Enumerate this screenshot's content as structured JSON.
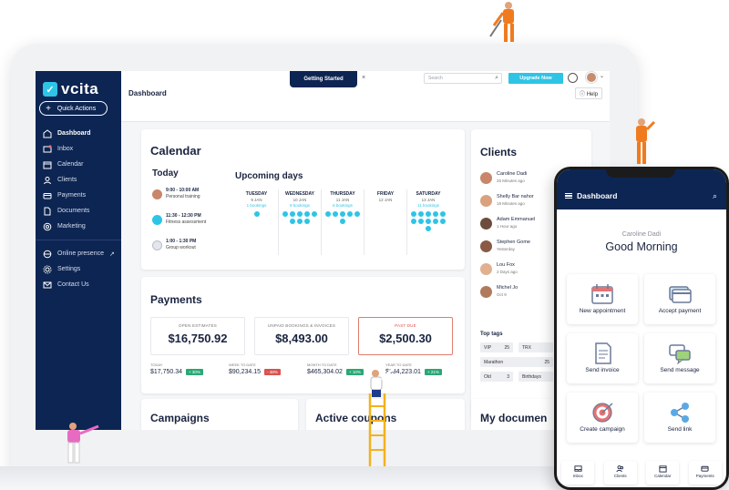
{
  "app": {
    "logo": "vcita",
    "logo_mark": "✓"
  },
  "sidebar": {
    "quick_actions": "Quick Actions",
    "items": [
      {
        "label": "Dashboard",
        "icon": "dashboard-icon"
      },
      {
        "label": "Inbox",
        "icon": "inbox-icon"
      },
      {
        "label": "Calendar",
        "icon": "calendar-icon"
      },
      {
        "label": "Clients",
        "icon": "clients-icon"
      },
      {
        "label": "Payments",
        "icon": "payments-icon"
      },
      {
        "label": "Documents",
        "icon": "documents-icon"
      },
      {
        "label": "Marketing",
        "icon": "marketing-icon"
      }
    ],
    "bottom_items": [
      {
        "label": "Online presence",
        "icon": "online-presence-icon"
      },
      {
        "label": "Settings",
        "icon": "settings-icon"
      },
      {
        "label": "Contact Us",
        "icon": "contact-icon"
      }
    ]
  },
  "header": {
    "title": "Dashboard",
    "getting_started": "Getting Started",
    "close": "×",
    "search_placeholder": "Search",
    "upgrade": "Upgrade Now",
    "help": "Help"
  },
  "calendar": {
    "title": "Calendar",
    "today_label": "Today",
    "today": [
      {
        "time": "9:00 - 10:00 AM",
        "name": "Personal training"
      },
      {
        "time": "11:30 - 12:30 PM",
        "name": "Fitness assessment"
      },
      {
        "time": "1:00 - 1:30 PM",
        "name": "Group workout"
      }
    ],
    "upcoming_label": "Upcoming days",
    "days": [
      {
        "name": "TUESDAY",
        "date": "9 JAN",
        "bookings": "1 bookings",
        "dots": 1
      },
      {
        "name": "WEDNESDAY",
        "date": "10 JAN",
        "bookings": "8 bookings",
        "dots": 8
      },
      {
        "name": "THURSDAY",
        "date": "11 JAN",
        "bookings": "6 bookings",
        "dots": 6
      },
      {
        "name": "FRIDAY",
        "date": "12 JAN",
        "bookings": "",
        "dots": 0
      },
      {
        "name": "SATURDAY",
        "date": "13 JAN",
        "bookings": "11 bookings",
        "dots": 11
      }
    ]
  },
  "clients": {
    "title": "Clients",
    "list": [
      {
        "name": "Caroline Dadi",
        "when": "25 Minutes ago"
      },
      {
        "name": "Shelly Bar nahor",
        "when": "18 Minutes ago"
      },
      {
        "name": "Adam Emmanuel",
        "when": "1 Hour ago"
      },
      {
        "name": "Stephen Gome",
        "when": "Yesterday"
      },
      {
        "name": "Lou Fox",
        "when": "2 Days ago"
      },
      {
        "name": "Michel Jo",
        "when": "Oct 9"
      }
    ],
    "tags_label": "Top tags",
    "tags": [
      {
        "name": "VIP",
        "count": "25"
      },
      {
        "name": "TRX",
        "count": ""
      },
      {
        "name": "Marathon",
        "count": "25"
      },
      {
        "name": "Old",
        "count": "3"
      },
      {
        "name": "Birthdays",
        "count": ""
      }
    ]
  },
  "payments": {
    "title": "Payments",
    "boxes": [
      {
        "label": "OPEN ESTIMATES",
        "value": "$16,750.92"
      },
      {
        "label": "UNPAID BOOKINGS & INVOICES",
        "value": "$8,493.00"
      },
      {
        "label": "PAST DUE",
        "value": "$2,500.30"
      }
    ],
    "stats": [
      {
        "label": "TODAY",
        "value": "$17,750.34",
        "change": "+ 30%",
        "dir": "up"
      },
      {
        "label": "WEEK TO DATE",
        "value": "$90,234.15",
        "change": "- 48%",
        "dir": "down"
      },
      {
        "label": "MONTH TO DATE",
        "value": "$465,304.02",
        "change": "+ 10%",
        "dir": "up"
      },
      {
        "label": "YEAR TO DATE",
        "value": "$634,223.01",
        "change": "+ 21%",
        "dir": "up"
      }
    ]
  },
  "bottom_cards": [
    "Campaigns",
    "Active coupons",
    "My documen"
  ],
  "phone": {
    "title": "Dashboard",
    "user": "Caroline Dadi",
    "greeting": "Good Morning",
    "tiles": [
      {
        "label": "New appointment",
        "icon": "calendar-icon"
      },
      {
        "label": "Accept payment",
        "icon": "credit-card-icon"
      },
      {
        "label": "Send invoice",
        "icon": "invoice-icon"
      },
      {
        "label": "Send message",
        "icon": "message-icon"
      },
      {
        "label": "Create campaign",
        "icon": "target-icon"
      },
      {
        "label": "Send link",
        "icon": "share-icon"
      }
    ],
    "tabs": [
      {
        "label": "Inbox",
        "icon": "inbox-icon"
      },
      {
        "label": "Clients",
        "icon": "clients-icon"
      },
      {
        "label": "Calendar",
        "icon": "calendar-icon"
      },
      {
        "label": "Payments",
        "icon": "payments-icon"
      }
    ]
  },
  "colors": {
    "navy": "#0d2552",
    "accent": "#2ec4e6",
    "success": "#2aa876",
    "danger": "#d9534f"
  }
}
